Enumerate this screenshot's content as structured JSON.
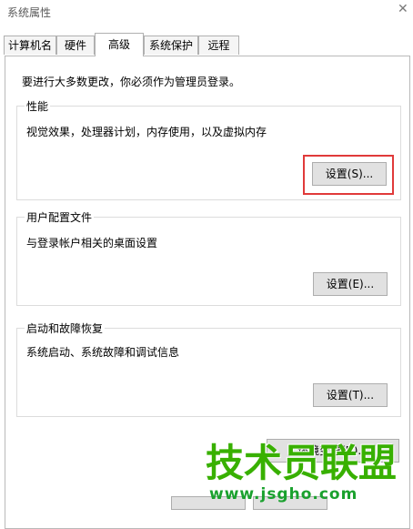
{
  "window": {
    "title": "系统属性",
    "close_icon": "close-icon"
  },
  "tabs": [
    {
      "label": "计算机名"
    },
    {
      "label": "硬件"
    },
    {
      "label": "高级",
      "active": true
    },
    {
      "label": "系统保护"
    },
    {
      "label": "远程"
    }
  ],
  "admin_note": "要进行大多数更改，你必须作为管理员登录。",
  "groups": {
    "performance": {
      "title": "性能",
      "desc": "视觉效果，处理器计划，内存使用，以及虚拟内存",
      "button": "设置(S)..."
    },
    "profiles": {
      "title": "用户配置文件",
      "desc": "与登录帐户相关的桌面设置",
      "button": "设置(E)..."
    },
    "startup": {
      "title": "启动和故障恢复",
      "desc": "系统启动、系统故障和调试信息",
      "button": "设置(T)..."
    }
  },
  "env_button": "环境变量(N)...",
  "watermark": {
    "main": "技术员联盟",
    "url": "www.jsgho.com"
  },
  "colors": {
    "highlight": "#e03a3a",
    "watermark": "#38b000"
  }
}
